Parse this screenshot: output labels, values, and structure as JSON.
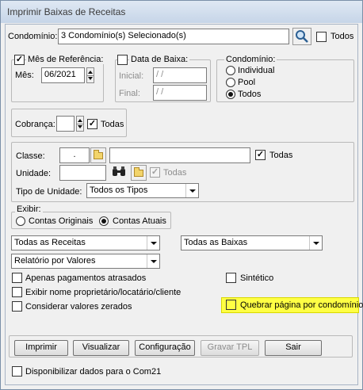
{
  "window": {
    "title": "Imprimir Baixas de Receitas"
  },
  "condominio": {
    "label": "Condomínio:",
    "value": "3 Condomínio(s) Selecionado(s)",
    "todos_label": "Todos",
    "todos_checked": false
  },
  "mes_referencia": {
    "label": "Mês de Referência:",
    "checked": true,
    "mes_label": "Mês:",
    "mes_value": "06/2021"
  },
  "data_baixa": {
    "label": "Data de Baixa:",
    "checked": false,
    "inicial_label": "Inicial:",
    "inicial_value": " / /",
    "final_label": "Final:",
    "final_value": " / /"
  },
  "condominio_tipo": {
    "label": "Condomínio:",
    "options": [
      "Individual",
      "Pool",
      "Todos"
    ],
    "selected": "Todos"
  },
  "cobranca": {
    "label": "Cobrança:",
    "value": "",
    "todas_label": "Todas",
    "todas_checked": true
  },
  "classe": {
    "label": "Classe:",
    "code_value": ".",
    "desc_value": "",
    "todas_label": "Todas",
    "todas_checked": true
  },
  "unidade": {
    "label": "Unidade:",
    "value": "",
    "todas_label": "Todas",
    "todas_checked": true
  },
  "tipo_unidade": {
    "label": "Tipo de Unidade:",
    "value": "Todos os Tipos"
  },
  "exibir": {
    "label": "Exibir:",
    "options": [
      "Contas Originais",
      "Contas Atuais"
    ],
    "selected": "Contas Atuais"
  },
  "receitas_select": "Todas as Receitas",
  "baixas_select": "Todas as Baixas",
  "relatorio_select": "Relatório por Valores",
  "options": {
    "apenas_atrasados": "Apenas pagamentos atrasados",
    "sintetico": "Sintético",
    "exibir_nome": "Exibir nome proprietário/locatário/cliente",
    "considerar_zerados": "Considerar valores zerados",
    "quebrar_pagina": "Quebrar página por condomínio"
  },
  "buttons": {
    "imprimir": "Imprimir",
    "visualizar": "Visualizar",
    "configuracao": "Configuração",
    "gravar_tpl": "Gravar TPL",
    "sair": "Sair"
  },
  "disponibilizar": "Disponibilizar dados para o Com21",
  "colors": {
    "highlight": "#ffff44",
    "titlebar": "#c6d5e8"
  }
}
